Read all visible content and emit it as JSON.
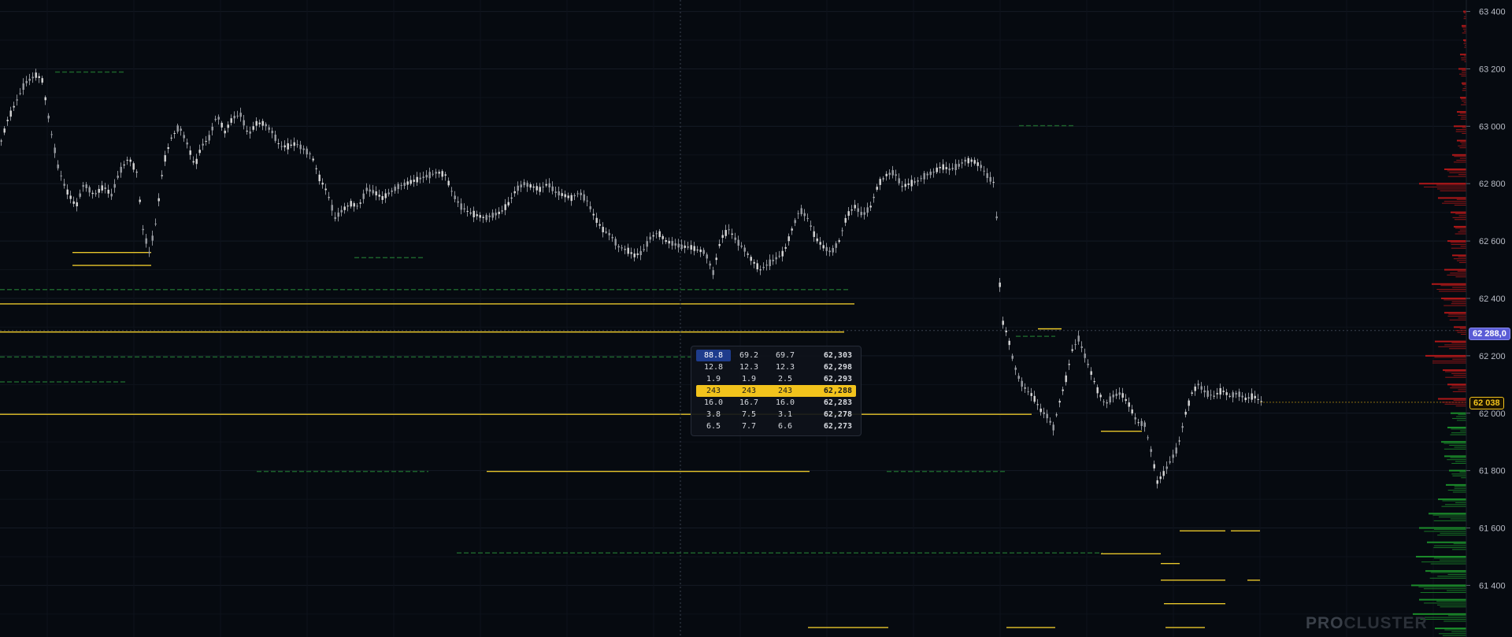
{
  "chart_data": {
    "type": "candlestick",
    "y_axis": {
      "position": "right",
      "ylim": [
        61220,
        63440
      ],
      "ticks": [
        63400,
        63200,
        63000,
        62800,
        62600,
        62400,
        62200,
        62000,
        61800,
        61600,
        61400
      ],
      "tick_labels": [
        "63 400",
        "63 200",
        "63 000",
        "62 800",
        "62 600",
        "62 400",
        "62 200",
        "62 000",
        "61 800",
        "61 600",
        "61 400"
      ]
    },
    "grid": true,
    "price_path": [
      [
        0,
        62950
      ],
      [
        8,
        63020
      ],
      [
        18,
        63080
      ],
      [
        30,
        63150
      ],
      [
        45,
        63180
      ],
      [
        52,
        63160
      ],
      [
        62,
        63000
      ],
      [
        72,
        62860
      ],
      [
        82,
        62780
      ],
      [
        95,
        62720
      ],
      [
        105,
        62800
      ],
      [
        118,
        62760
      ],
      [
        130,
        62790
      ],
      [
        140,
        62760
      ],
      [
        150,
        62840
      ],
      [
        162,
        62890
      ],
      [
        172,
        62840
      ],
      [
        180,
        62640
      ],
      [
        188,
        62560
      ],
      [
        196,
        62660
      ],
      [
        206,
        62870
      ],
      [
        216,
        62960
      ],
      [
        226,
        63000
      ],
      [
        236,
        62940
      ],
      [
        246,
        62860
      ],
      [
        254,
        62930
      ],
      [
        264,
        62960
      ],
      [
        274,
        63040
      ],
      [
        284,
        62980
      ],
      [
        294,
        63030
      ],
      [
        304,
        63040
      ],
      [
        314,
        62970
      ],
      [
        324,
        63010
      ],
      [
        334,
        63010
      ],
      [
        344,
        62980
      ],
      [
        354,
        62930
      ],
      [
        364,
        62930
      ],
      [
        374,
        62940
      ],
      [
        384,
        62920
      ],
      [
        394,
        62900
      ],
      [
        404,
        62820
      ],
      [
        414,
        62770
      ],
      [
        424,
        62680
      ],
      [
        434,
        62710
      ],
      [
        444,
        62730
      ],
      [
        454,
        62720
      ],
      [
        464,
        62780
      ],
      [
        474,
        62770
      ],
      [
        484,
        62750
      ],
      [
        494,
        62770
      ],
      [
        504,
        62790
      ],
      [
        514,
        62800
      ],
      [
        524,
        62810
      ],
      [
        534,
        62820
      ],
      [
        544,
        62830
      ],
      [
        554,
        62840
      ],
      [
        564,
        62830
      ],
      [
        574,
        62760
      ],
      [
        584,
        62720
      ],
      [
        594,
        62700
      ],
      [
        604,
        62690
      ],
      [
        614,
        62680
      ],
      [
        624,
        62690
      ],
      [
        634,
        62700
      ],
      [
        644,
        62730
      ],
      [
        654,
        62780
      ],
      [
        664,
        62800
      ],
      [
        674,
        62790
      ],
      [
        684,
        62780
      ],
      [
        694,
        62800
      ],
      [
        704,
        62770
      ],
      [
        714,
        62760
      ],
      [
        724,
        62750
      ],
      [
        734,
        62770
      ],
      [
        744,
        62740
      ],
      [
        754,
        62680
      ],
      [
        764,
        62640
      ],
      [
        774,
        62620
      ],
      [
        784,
        62580
      ],
      [
        794,
        62570
      ],
      [
        804,
        62550
      ],
      [
        814,
        62560
      ],
      [
        824,
        62610
      ],
      [
        834,
        62630
      ],
      [
        844,
        62600
      ],
      [
        854,
        62590
      ],
      [
        864,
        62580
      ],
      [
        874,
        62580
      ],
      [
        884,
        62570
      ],
      [
        894,
        62560
      ],
      [
        904,
        62490
      ],
      [
        914,
        62610
      ],
      [
        924,
        62640
      ],
      [
        934,
        62600
      ],
      [
        944,
        62570
      ],
      [
        954,
        62530
      ],
      [
        964,
        62500
      ],
      [
        974,
        62520
      ],
      [
        984,
        62540
      ],
      [
        994,
        62560
      ],
      [
        1004,
        62640
      ],
      [
        1014,
        62710
      ],
      [
        1024,
        62680
      ],
      [
        1034,
        62610
      ],
      [
        1044,
        62580
      ],
      [
        1054,
        62560
      ],
      [
        1064,
        62600
      ],
      [
        1074,
        62690
      ],
      [
        1084,
        62720
      ],
      [
        1094,
        62690
      ],
      [
        1104,
        62720
      ],
      [
        1114,
        62800
      ],
      [
        1124,
        62830
      ],
      [
        1134,
        62840
      ],
      [
        1144,
        62790
      ],
      [
        1154,
        62800
      ],
      [
        1164,
        62810
      ],
      [
        1174,
        62830
      ],
      [
        1184,
        62840
      ],
      [
        1194,
        62860
      ],
      [
        1204,
        62850
      ],
      [
        1214,
        62860
      ],
      [
        1224,
        62880
      ],
      [
        1234,
        62880
      ],
      [
        1244,
        62860
      ],
      [
        1254,
        62820
      ],
      [
        1262,
        62800
      ],
      [
        1270,
        62330
      ],
      [
        1278,
        62270
      ],
      [
        1286,
        62170
      ],
      [
        1294,
        62110
      ],
      [
        1302,
        62080
      ],
      [
        1310,
        62060
      ],
      [
        1320,
        62010
      ],
      [
        1328,
        61990
      ],
      [
        1336,
        61950
      ],
      [
        1344,
        62040
      ],
      [
        1352,
        62120
      ],
      [
        1360,
        62220
      ],
      [
        1368,
        62260
      ],
      [
        1376,
        62200
      ],
      [
        1384,
        62140
      ],
      [
        1392,
        62080
      ],
      [
        1402,
        62030
      ],
      [
        1412,
        62060
      ],
      [
        1422,
        62070
      ],
      [
        1432,
        62030
      ],
      [
        1442,
        61970
      ],
      [
        1452,
        61960
      ],
      [
        1460,
        61870
      ],
      [
        1468,
        61760
      ],
      [
        1476,
        61790
      ],
      [
        1484,
        61830
      ],
      [
        1494,
        61880
      ],
      [
        1504,
        62000
      ],
      [
        1512,
        62070
      ],
      [
        1520,
        62100
      ],
      [
        1530,
        62070
      ],
      [
        1540,
        62060
      ],
      [
        1550,
        62080
      ],
      [
        1560,
        62060
      ],
      [
        1570,
        62070
      ],
      [
        1580,
        62050
      ],
      [
        1590,
        62060
      ],
      [
        1600,
        62040
      ]
    ],
    "level_lines": [
      {
        "x0": 92,
        "x1": 192,
        "price": 62560,
        "color": "#e8c62a"
      },
      {
        "x0": 92,
        "x1": 192,
        "price": 62515,
        "color": "#e8c62a"
      },
      {
        "x0": 0,
        "x1": 1085,
        "price": 62381,
        "color": "#e8c62a"
      },
      {
        "x0": 0,
        "x1": 1072,
        "price": 62283,
        "color": "#e8c62a"
      },
      {
        "x0": 0,
        "x1": 1310,
        "price": 61996,
        "color": "#e8c62a"
      },
      {
        "x0": 618,
        "x1": 1028,
        "price": 61797,
        "color": "#e8c62a"
      },
      {
        "x0": 1398,
        "x1": 1450,
        "price": 61937,
        "color": "#e8c62a"
      },
      {
        "x0": 1318,
        "x1": 1348,
        "price": 62294,
        "color": "#e8c62a"
      },
      {
        "x0": 1498,
        "x1": 1556,
        "price": 61590,
        "color": "#e8c62a"
      },
      {
        "x0": 1563,
        "x1": 1600,
        "price": 61590,
        "color": "#e8c62a"
      },
      {
        "x0": 1398,
        "x1": 1474,
        "price": 61510,
        "color": "#e8c62a"
      },
      {
        "x0": 1474,
        "x1": 1498,
        "price": 61476,
        "color": "#e8c62a"
      },
      {
        "x0": 1474,
        "x1": 1556,
        "price": 61418,
        "color": "#e8c62a"
      },
      {
        "x0": 1584,
        "x1": 1600,
        "price": 61418,
        "color": "#e8c62a"
      },
      {
        "x0": 1478,
        "x1": 1556,
        "price": 61336,
        "color": "#e8c62a"
      },
      {
        "x0": 1026,
        "x1": 1128,
        "price": 61253,
        "color": "#e8c62a"
      },
      {
        "x0": 1278,
        "x1": 1340,
        "price": 61253,
        "color": "#e8c62a"
      },
      {
        "x0": 1480,
        "x1": 1530,
        "price": 61253,
        "color": "#e8c62a"
      }
    ],
    "density_lines": [
      {
        "x0": 0,
        "x1": 1080,
        "price": 62431
      },
      {
        "x0": 450,
        "x1": 540,
        "price": 62542
      },
      {
        "x0": 0,
        "x1": 880,
        "price": 62196
      },
      {
        "x0": 0,
        "x1": 160,
        "price": 62109
      },
      {
        "x0": 326,
        "x1": 544,
        "price": 61797
      },
      {
        "x0": 1126,
        "x1": 1276,
        "price": 61797
      },
      {
        "x0": 580,
        "x1": 1400,
        "price": 61513
      },
      {
        "x0": 70,
        "x1": 160,
        "price": 63189
      },
      {
        "x0": 1294,
        "x1": 1366,
        "price": 63002
      },
      {
        "x0": 1290,
        "x1": 1340,
        "price": 62268
      }
    ],
    "crosshair": {
      "x": 864,
      "price": 62288
    },
    "last_price": 62038,
    "volume_profile": {
      "buckets": [
        63400,
        63350,
        63300,
        63250,
        63200,
        63150,
        63100,
        63050,
        63000,
        62950,
        62900,
        62850,
        62800,
        62750,
        62700,
        62650,
        62600,
        62550,
        62500,
        62450,
        62400,
        62350,
        62300,
        62250,
        62200,
        62150,
        62100,
        62050,
        62000,
        61950,
        61900,
        61850,
        61800,
        61750,
        61700,
        61650,
        61600,
        61550,
        61500,
        61450,
        61400,
        61350,
        61300,
        61250
      ],
      "values": [
        2,
        3,
        2,
        4,
        5,
        3,
        4,
        6,
        8,
        6,
        9,
        14,
        30,
        18,
        10,
        8,
        12,
        9,
        14,
        22,
        16,
        14,
        8,
        20,
        26,
        15,
        12,
        18,
        10,
        12,
        16,
        14,
        11,
        13,
        18,
        24,
        30,
        25,
        32,
        26,
        35,
        30,
        34,
        20
      ]
    }
  },
  "tooltip": {
    "rows": [
      [
        "88.8",
        "69.2",
        "69.7",
        "62,303"
      ],
      [
        "12.8",
        "12.3",
        "12.3",
        "62,298"
      ],
      [
        "1.9",
        "1.9",
        "2.5",
        "62,293"
      ],
      [
        "243",
        "243",
        "243",
        "62,288"
      ],
      [
        "16.0",
        "16.7",
        "16.0",
        "62,283"
      ],
      [
        "3.8",
        "7.5",
        "3.1",
        "62,278"
      ],
      [
        "6.5",
        "7.7",
        "6.6",
        "62,273"
      ]
    ],
    "highlight_index": 3
  },
  "price_tags": {
    "cursor": "62 288,0",
    "last": "62 038"
  },
  "logo": {
    "pro": "PRO",
    "rest": "CLUSTER"
  },
  "colors": {
    "background": "#060a10",
    "grid": "#141a24",
    "candle": "#d8d8d8",
    "level": "#e8c62a",
    "density": "#1f6b2e",
    "profile_sell": "#c21a1a",
    "profile_buy": "#1e9a2e",
    "cursor_tag": "#5a5cd6",
    "last_tag": "#f2c31c"
  }
}
